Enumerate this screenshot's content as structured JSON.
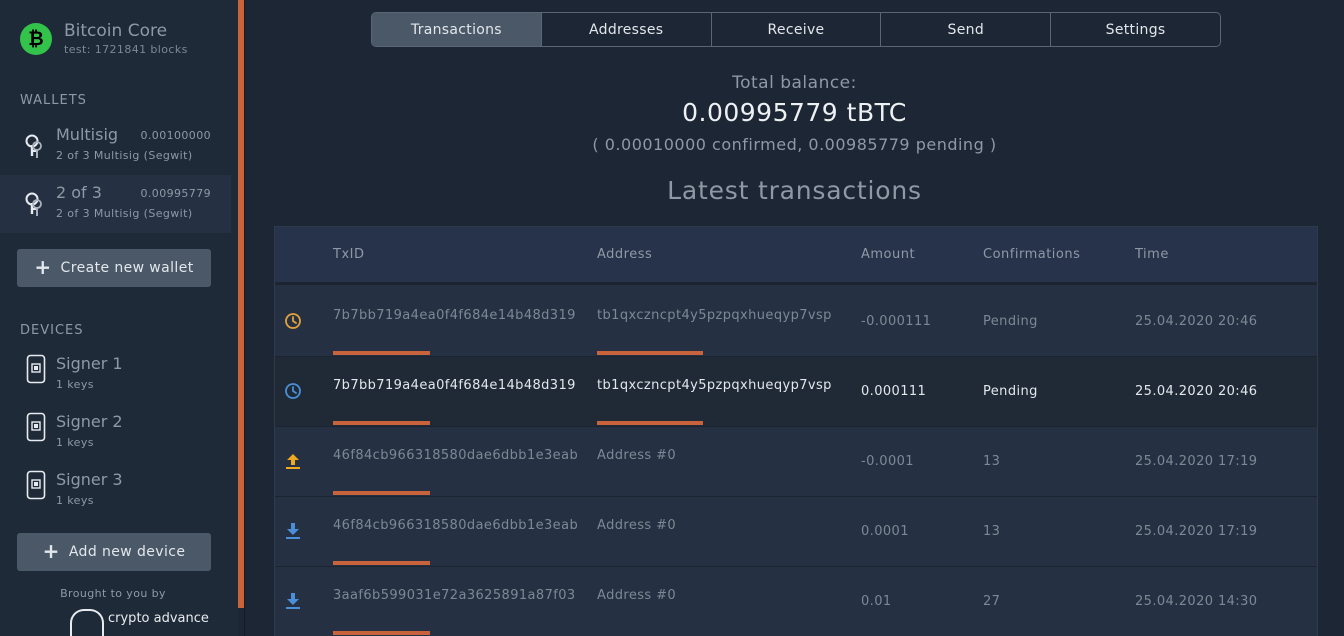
{
  "app": {
    "name": "Bitcoin Core",
    "network": "test: 1721841 blocks",
    "logo_glyph": "₿"
  },
  "sidebar": {
    "wallets_title": "WALLETS",
    "wallets": [
      {
        "name": "Multisig",
        "balance": "0.00100000",
        "subtitle": "2 of 3 Multisig (Segwit)",
        "active": false
      },
      {
        "name": "2 of 3",
        "balance": "0.00995779",
        "subtitle": "2 of 3 Multisig (Segwit)",
        "active": true
      }
    ],
    "create_wallet_label": "Create new wallet",
    "devices_title": "DEVICES",
    "devices": [
      {
        "name": "Signer 1",
        "subtitle": "1 keys"
      },
      {
        "name": "Signer 2",
        "subtitle": "1 keys"
      },
      {
        "name": "Signer 3",
        "subtitle": "1 keys"
      }
    ],
    "add_device_label": "Add new device",
    "brought_by": "Brought to you by",
    "partner_name": "crypto advance"
  },
  "tabs": [
    "Transactions",
    "Addresses",
    "Receive",
    "Send",
    "Settings"
  ],
  "active_tab": "Transactions",
  "balance": {
    "label": "Total balance:",
    "value": "0.00995779 tBTC",
    "detail": "( 0.00010000 confirmed, 0.00985779 pending )"
  },
  "transactions": {
    "title": "Latest transactions",
    "columns": [
      "TxID",
      "Address",
      "Amount",
      "Confirmations",
      "Time"
    ],
    "rows": [
      {
        "icon": "clock-icon",
        "icon_color": "#e3a23b",
        "txid": "7b7bb719a4ea0f4f684e14b48d319",
        "address": "tb1qxczncpt4y5pzpqxhueqyp7vsp",
        "amount": "-0.000111",
        "confirmations": "Pending",
        "time": "25.04.2020 20:46",
        "highlight": false
      },
      {
        "icon": "clock-icon",
        "icon_color": "#4a8fd8",
        "txid": "7b7bb719a4ea0f4f684e14b48d319",
        "address": "tb1qxczncpt4y5pzpqxhueqyp7vsp",
        "amount": "0.000111",
        "confirmations": "Pending",
        "time": "25.04.2020 20:46",
        "highlight": true
      },
      {
        "icon": "upload-icon",
        "icon_color": "#f0a81e",
        "txid": "46f84cb966318580dae6dbb1e3eab",
        "address": "Address #0",
        "amount": "-0.0001",
        "confirmations": "13",
        "time": "25.04.2020 17:19",
        "highlight": false
      },
      {
        "icon": "download-icon",
        "icon_color": "#4a8fd8",
        "txid": "46f84cb966318580dae6dbb1e3eab",
        "address": "Address #0",
        "amount": "0.0001",
        "confirmations": "13",
        "time": "25.04.2020 17:19",
        "highlight": false
      },
      {
        "icon": "download-icon",
        "icon_color": "#4a8fd8",
        "txid": "3aaf6b599031e72a3625891a87f03",
        "address": "Address #0",
        "amount": "0.01",
        "confirmations": "27",
        "time": "25.04.2020 14:30",
        "highlight": false
      }
    ]
  },
  "colors": {
    "accent": "#c8633c",
    "brand_green": "#33c24a"
  }
}
